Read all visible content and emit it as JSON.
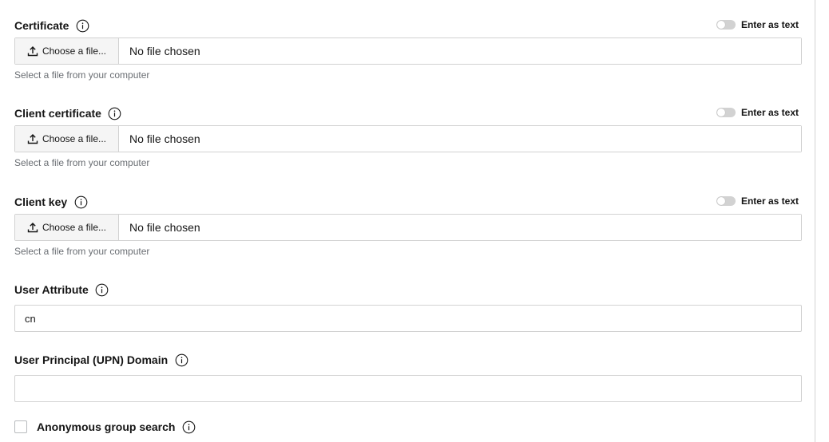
{
  "certificate": {
    "label": "Certificate",
    "toggle_label": "Enter as text",
    "button_label": "Choose a file...",
    "file_name": "No file chosen",
    "helper": "Select a file from your computer"
  },
  "client_certificate": {
    "label": "Client certificate",
    "toggle_label": "Enter as text",
    "button_label": "Choose a file...",
    "file_name": "No file chosen",
    "helper": "Select a file from your computer"
  },
  "client_key": {
    "label": "Client key",
    "toggle_label": "Enter as text",
    "button_label": "Choose a file...",
    "file_name": "No file chosen",
    "helper": "Select a file from your computer"
  },
  "user_attribute": {
    "label": "User Attribute",
    "value": "cn"
  },
  "upn_domain": {
    "label": "User Principal (UPN) Domain",
    "value": ""
  },
  "anonymous_group_search": {
    "label": "Anonymous group search",
    "checked": false
  },
  "icons": {
    "info": "info-circle-icon",
    "upload": "upload-icon"
  },
  "colors": {
    "border": "#d2d2d2",
    "helper_text": "#6a6e73",
    "button_bg": "#f5f5f5"
  }
}
